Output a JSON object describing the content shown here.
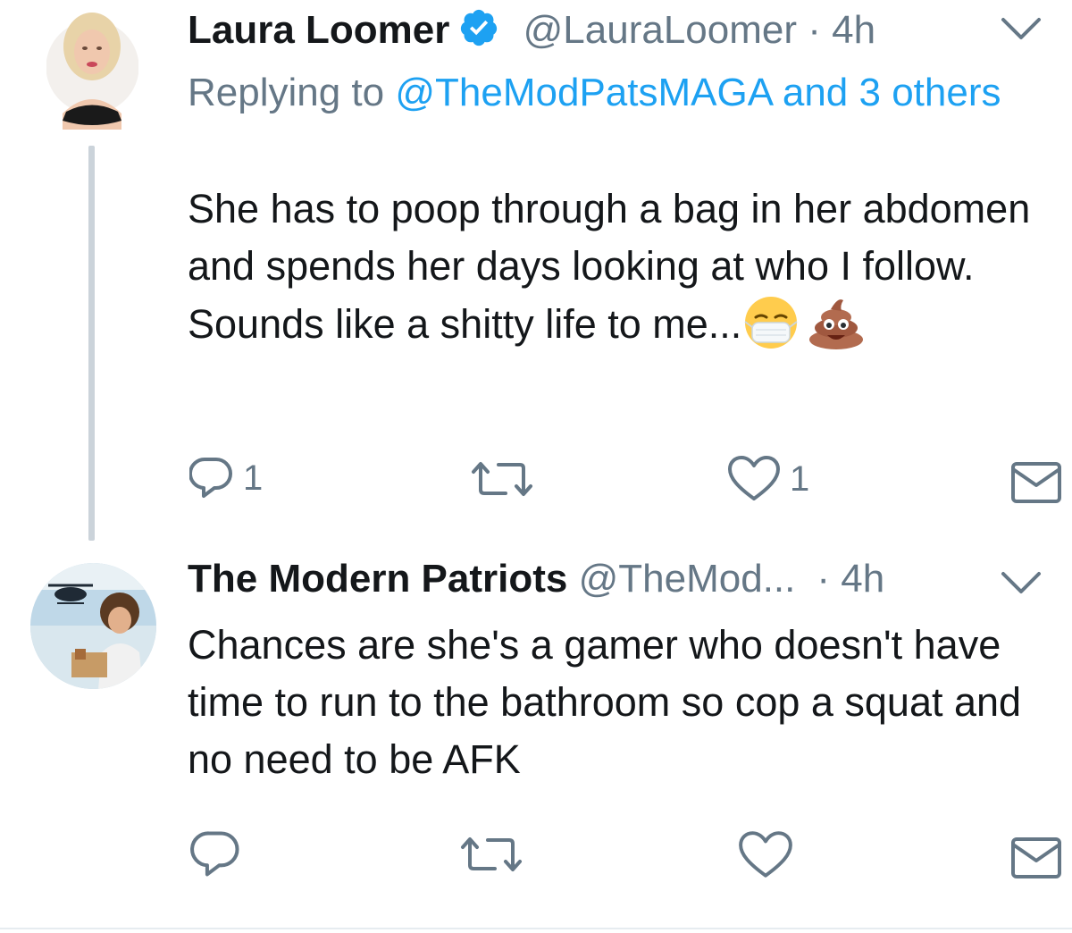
{
  "tweets": [
    {
      "author_name": "Laura Loomer",
      "verified": true,
      "handle": "@LauraLoomer",
      "separator": "·",
      "time": "4h",
      "replying_prefix": "Replying to",
      "replying_mentions": "@TheModPatsMAGA and 3 others",
      "text": "She has to poop through a bag in her abdomen and spends her days looking at who I follow. Sounds like a shitty life to me...",
      "emojis": [
        "face-with-medical-mask-emoji",
        "pile-of-poo-emoji"
      ],
      "reply_count": "1",
      "retweet_count": "",
      "like_count": "1"
    },
    {
      "author_name": "The Modern Patriots",
      "verified": false,
      "handle": "@TheMod...",
      "separator": "·",
      "time": "4h",
      "text": "Chances are she's a gamer who doesn't have time to run to the bathroom so cop a squat and no need to be AFK",
      "reply_count": "",
      "retweet_count": "",
      "like_count": ""
    }
  ],
  "colors": {
    "text_primary": "#14171a",
    "text_secondary": "#657786",
    "link": "#1da1f2",
    "verified_badge": "#1da1f2",
    "thread_line": "#cbd3da"
  },
  "icons": [
    "chevron-down-icon",
    "verified-badge-icon",
    "reply-icon",
    "retweet-icon",
    "like-icon",
    "direct-message-icon"
  ]
}
